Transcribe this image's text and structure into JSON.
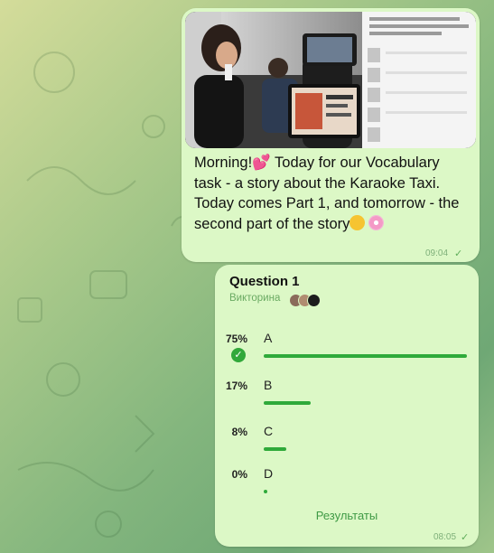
{
  "message1": {
    "text_line1": "Morning!",
    "text_line1b": " Today for our",
    "text_rest": "Vocabulary task - a story about the Karaoke Taxi. Today comes Part 1, and tomorrow - the second part of the story",
    "time": "09:04"
  },
  "poll": {
    "question": "Question 1",
    "type_label": "Викторина",
    "options": [
      {
        "label": "A",
        "percent": "75%",
        "fraction": 1.0,
        "correct": true
      },
      {
        "label": "B",
        "percent": "17%",
        "fraction": 0.23
      },
      {
        "label": "C",
        "percent": "8%",
        "fraction": 0.11
      },
      {
        "label": "D",
        "percent": "0%",
        "fraction": 0.0
      }
    ],
    "results_label": "Результаты",
    "time": "08:05"
  },
  "colors": {
    "bubble": "#dcf8c6",
    "bar": "#2faa3a",
    "accent_text": "#3f9a45"
  },
  "icons": [
    "heart-emoji-icon",
    "grinning-face-icon",
    "flower-emoji-icon",
    "check-circle-icon",
    "double-check-icon"
  ]
}
